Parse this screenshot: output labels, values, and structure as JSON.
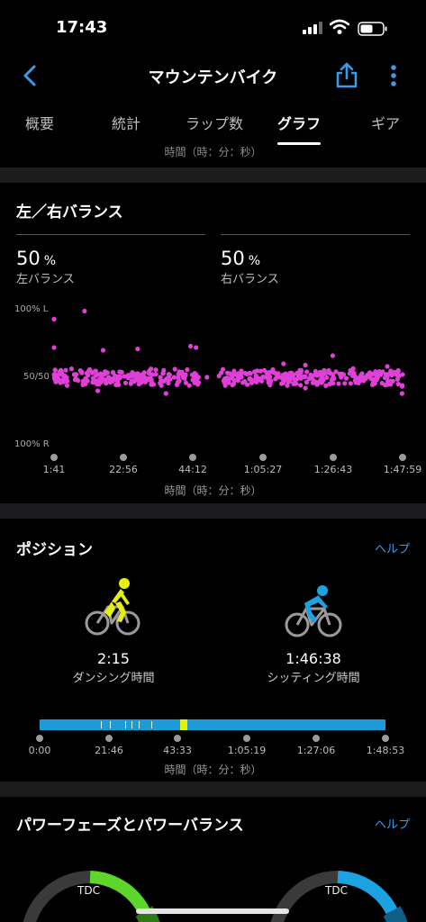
{
  "status_bar": {
    "time": "17:43"
  },
  "nav": {
    "title": "マウンテンバイク"
  },
  "tabs": [
    {
      "label": "概要"
    },
    {
      "label": "統計"
    },
    {
      "label": "ラップ数"
    },
    {
      "label": "グラフ"
    },
    {
      "label": "ギア"
    }
  ],
  "tabs_sub": "時間（時：分：秒）",
  "balance": {
    "title": "左／右バランス",
    "left": {
      "value": "50",
      "unit": "%",
      "label": "左バランス"
    },
    "right": {
      "value": "50",
      "unit": "%",
      "label": "右バランス"
    },
    "y_labels": {
      "top": "100% L",
      "mid": "50/50",
      "bottom": "100% R"
    },
    "x_ticks": [
      "1:41",
      "22:56",
      "44:12",
      "1:05:27",
      "1:26:43",
      "1:47:59"
    ],
    "x_caption": "時間（時：分：秒）",
    "color": "#e040d8"
  },
  "chart_data": {
    "type": "scatter",
    "title": "左／右バランス",
    "xlabel": "時間（時：分：秒）",
    "ylabel": "",
    "x_ticks": [
      "1:41",
      "22:56",
      "44:12",
      "1:05:27",
      "1:26:43",
      "1:47:59"
    ],
    "y_ticks": [
      "100% L",
      "50/50",
      "100% R"
    ],
    "y_range_percent_left": [
      0,
      100
    ],
    "note_units": "x in seconds of elapsed time; y in percent left share (50 = balanced)",
    "series": [
      {
        "points": [
          [
            101,
            93
          ],
          [
            660,
            99
          ],
          [
            101,
            72
          ],
          [
            1000,
            70
          ],
          [
            1630,
            71
          ],
          [
            2600,
            73
          ],
          [
            2700,
            72
          ],
          [
            3120,
            51
          ],
          [
            3300,
            46
          ],
          [
            3500,
            51
          ],
          [
            4300,
            60
          ],
          [
            4700,
            59
          ],
          [
            5200,
            66
          ],
          [
            5570,
            51
          ],
          [
            5900,
            49
          ],
          [
            6200,
            58
          ],
          [
            6400,
            55
          ],
          [
            6479,
            52
          ],
          [
            6470,
            44
          ],
          [
            6470,
            38
          ],
          [
            900,
            40
          ],
          [
            2150,
            38
          ],
          [
            4700,
            42
          ],
          [
            5000,
            46
          ],
          [
            101,
            52
          ],
          [
            300,
            51
          ],
          [
            500,
            49
          ],
          [
            700,
            53
          ],
          [
            900,
            52
          ],
          [
            1100,
            50
          ],
          [
            1300,
            54
          ],
          [
            1500,
            51
          ],
          [
            1700,
            48
          ],
          [
            1900,
            52
          ],
          [
            2100,
            53
          ],
          [
            2300,
            50
          ],
          [
            2500,
            51
          ],
          [
            2700,
            52
          ],
          [
            2900,
            50
          ],
          [
            3400,
            52
          ],
          [
            3600,
            53
          ],
          [
            3800,
            49
          ],
          [
            4000,
            51
          ],
          [
            4200,
            50
          ],
          [
            4400,
            52
          ],
          [
            4600,
            50
          ],
          [
            4800,
            51
          ],
          [
            5000,
            53
          ],
          [
            5200,
            49
          ],
          [
            5400,
            52
          ],
          [
            5600,
            51
          ],
          [
            5800,
            50
          ],
          [
            6000,
            52
          ],
          [
            6200,
            50
          ],
          [
            6400,
            51
          ]
        ]
      }
    ]
  },
  "position": {
    "title": "ポジション",
    "help": "ヘルプ",
    "standing": {
      "time": "2:15",
      "label": "ダンシング時間",
      "color": "#e5f00e"
    },
    "sitting": {
      "time": "1:46:38",
      "label": "シッティング時間",
      "color": "#1ca2e0"
    },
    "x_ticks": [
      "0:00",
      "21:46",
      "43:33",
      "1:05:19",
      "1:27:06",
      "1:48:53"
    ],
    "x_caption": "時間（時：分：秒）"
  },
  "power_phase": {
    "title": "パワーフェーズとパワーバランス",
    "help": "ヘルプ",
    "left_label": "TDC",
    "right_label": "TDC",
    "left_color": "#5cd62a",
    "right_color": "#1ca2e0"
  }
}
